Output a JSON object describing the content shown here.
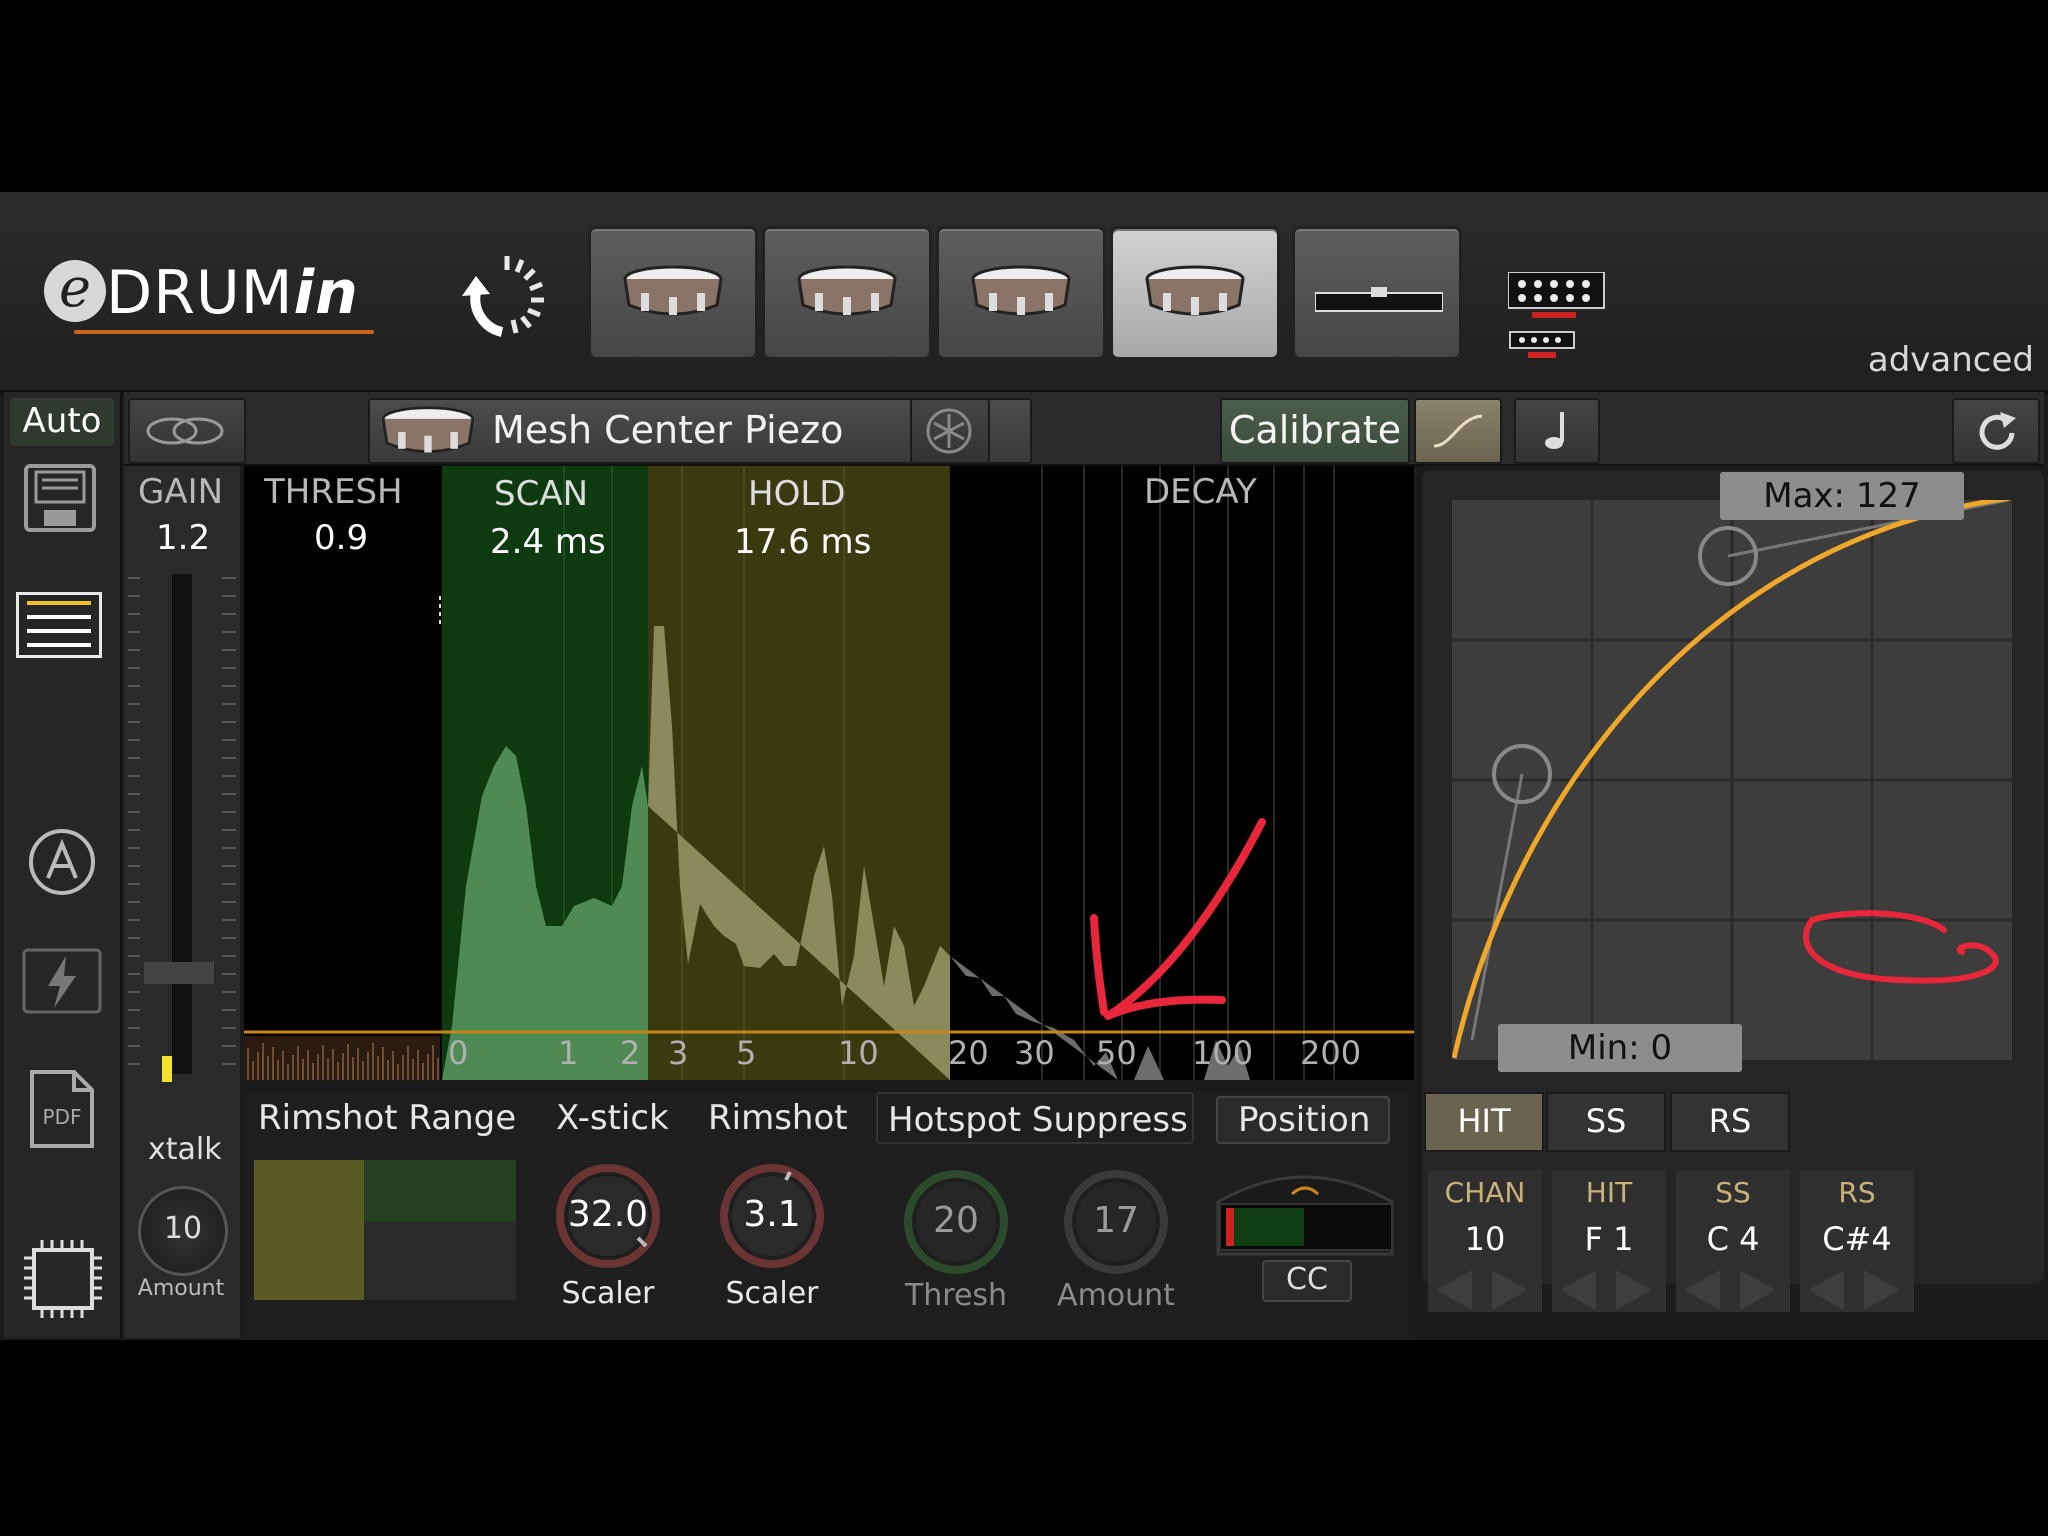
{
  "app": {
    "logo_prefix": "e",
    "logo_drum": "DRUM",
    "logo_suffix": "in",
    "mode_label": "advanced"
  },
  "pad_tabs": [
    {
      "kind": "snare-pad",
      "active": false
    },
    {
      "kind": "snare-pad",
      "active": false
    },
    {
      "kind": "snare-pad",
      "active": false
    },
    {
      "kind": "snare-pad",
      "active": true
    },
    {
      "kind": "cymbal-pedal",
      "active": false
    }
  ],
  "sidebar": {
    "auto_label": "Auto",
    "pdf_label": "PDF"
  },
  "pad_bar": {
    "pad_name": "Mesh Center Piezo",
    "calibrate_label": "Calibrate"
  },
  "gain": {
    "label": "GAIN",
    "value": "1.2",
    "xtalk_label": "xtalk",
    "xtalk_value": "10",
    "xtalk_sub": "Amount"
  },
  "graph": {
    "thresh_label": "THRESH",
    "thresh_value": "0.9",
    "scan_label": "SCAN",
    "scan_value": "2.4 ms",
    "hold_label": "HOLD",
    "hold_value": "17.6 ms",
    "decay_label": "DECAY",
    "axis_ticks": [
      "0",
      "1",
      "2",
      "3",
      "5",
      "10",
      "20",
      "30",
      "50",
      "100",
      "200"
    ]
  },
  "curve": {
    "max_label": "Max: 127",
    "min_label": "Min: 0"
  },
  "bottom": {
    "rimshot_range_label": "Rimshot Range",
    "xstick_label": "X-stick",
    "rimshot_label": "Rimshot",
    "hotspot_label": "Hotspot Suppress",
    "position_label": "Position",
    "xstick_value": "32.0",
    "xstick_sub": "Scaler",
    "rimshot_value": "3.1",
    "rimshot_sub": "Scaler",
    "hotspot_thresh_value": "20",
    "hotspot_thresh_sub": "Thresh",
    "hotspot_amount_value": "17",
    "hotspot_amount_sub": "Amount",
    "position_sub": "CC"
  },
  "mapping": {
    "tabs": [
      "HIT",
      "SS",
      "RS"
    ],
    "active_tab": "HIT",
    "columns": [
      {
        "header": "CHAN",
        "value": "10"
      },
      {
        "header": "HIT",
        "value": "F 1"
      },
      {
        "header": "SS",
        "value": "C 4"
      },
      {
        "header": "RS",
        "value": "C#4"
      }
    ]
  },
  "colors": {
    "scan": "#1f6b2a",
    "hold": "#6b6a18",
    "curve": "#f0a82a",
    "annotation": "#e8283a"
  }
}
